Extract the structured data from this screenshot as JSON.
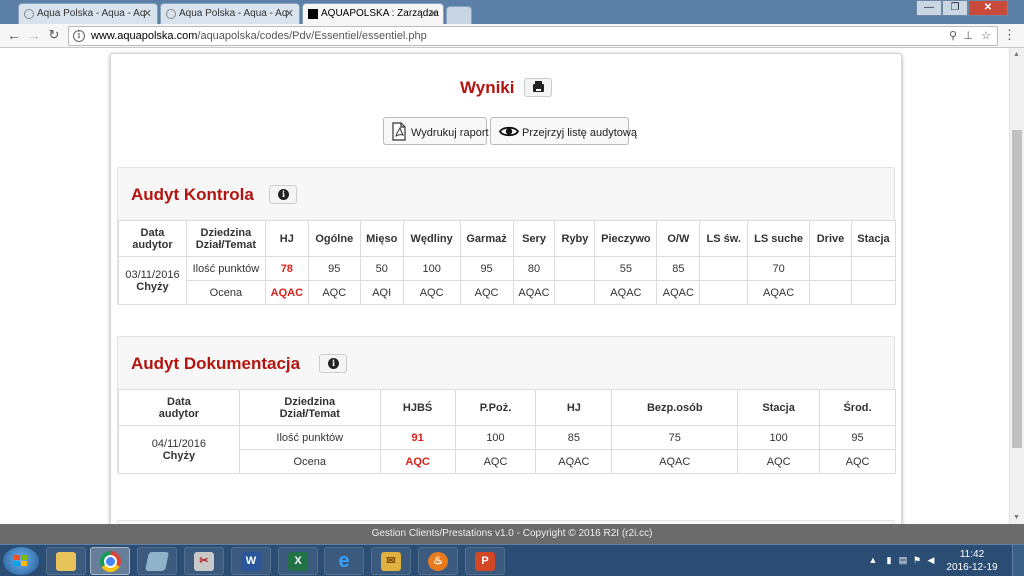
{
  "browser": {
    "tabs": [
      {
        "title": "Aqua Polska - Aqua - Aq",
        "active": false
      },
      {
        "title": "Aqua Polska - Aqua - Aq",
        "active": false
      },
      {
        "title": "AQUAPOLSKA : Zarządza",
        "active": true
      }
    ],
    "url_host": "www.aquapolska.com",
    "url_path": "/aquapolska/codes/Pdv/Essentiel/essentiel.php"
  },
  "page": {
    "title": "Wyniki",
    "buttons": {
      "print_report": "Wydrukuj raport",
      "view_audit_list": "Przejrzyj listę audytową"
    },
    "kontrola": {
      "title": "Audyt Kontrola",
      "col_date": "Data",
      "col_auditor": "audytor",
      "col_domain": "Dziedzina",
      "col_topic": "Dział/Temat",
      "columns": [
        "HJ",
        "Ogólne",
        "Mięso",
        "Wędliny",
        "Garmaż",
        "Sery",
        "Ryby",
        "Pieczywo",
        "O/W",
        "LS św.",
        "LS suche",
        "Drive",
        "Stacja"
      ],
      "date": "03/11/2016",
      "auditor": "Chyży",
      "row1_label": "Ilość punktów",
      "row1": [
        "78",
        "95",
        "50",
        "100",
        "95",
        "80",
        "",
        "55",
        "85",
        "",
        "70",
        "",
        ""
      ],
      "row2_label": "Ocena",
      "row2": [
        "AQAC",
        "AQC",
        "AQI",
        "AQC",
        "AQC",
        "AQAC",
        "",
        "AQAC",
        "AQAC",
        "",
        "AQAC",
        "",
        ""
      ]
    },
    "dokumentacja": {
      "title": "Audyt Dokumentacja",
      "col_date": "Data",
      "col_auditor": "audytor",
      "col_domain": "Dziedzina",
      "col_topic": "Dział/Temat",
      "columns": [
        "HJBŚ",
        "P.Poż.",
        "HJ",
        "Bezp.osób",
        "Stacja",
        "Środ."
      ],
      "date": "04/11/2016",
      "auditor": "Chyży",
      "row1_label": "Ilość punktów",
      "row1": [
        "91",
        "100",
        "85",
        "75",
        "100",
        "95"
      ],
      "row2_label": "Ocena",
      "row2": [
        "AQC",
        "AQC",
        "AQAC",
        "AQAC",
        "AQC",
        "AQC"
      ]
    }
  },
  "footer": {
    "text": "Gestion Clients/Prestations v1.0 - Copyright © 2016 R2I (r2i.cc)"
  },
  "taskbar": {
    "time": "11:42",
    "date": "2016-12-19"
  },
  "colors": {
    "title_red": "#b3140f",
    "highlight_red": "#d9201a",
    "taskbar": "#2b4d73"
  }
}
